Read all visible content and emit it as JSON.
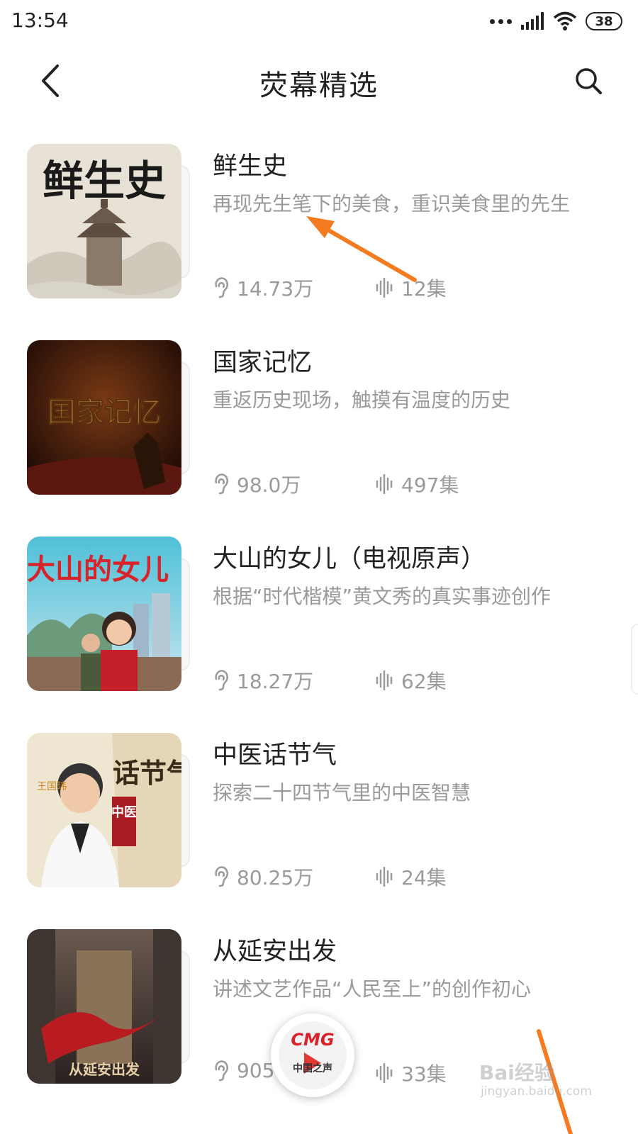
{
  "status_bar": {
    "time": "13:54",
    "battery": "38"
  },
  "header": {
    "title": "荧幕精选"
  },
  "items": [
    {
      "title": "鲜生史",
      "desc": "再现先生笔下的美食，重识美食里的先生",
      "plays": "14.73万",
      "episodes": "12集",
      "cover_text": "鲜生史"
    },
    {
      "title": "国家记忆",
      "desc": "重返历史现场，触摸有温度的历史",
      "plays": "98.0万",
      "episodes": "497集",
      "cover_text": "国家记忆"
    },
    {
      "title": "大山的女儿（电视原声）",
      "desc": "根据“时代楷模”黄文秀的真实事迹创作",
      "plays": "18.27万",
      "episodes": "62集",
      "cover_text": "大山的女儿"
    },
    {
      "title": "中医话节气",
      "desc": "探索二十四节气里的中医智慧",
      "plays": "80.25万",
      "episodes": "24集",
      "cover_text": "话节气",
      "cover_sub": "中医",
      "cover_name": "王国玮"
    },
    {
      "title": "从延安出发",
      "desc": "讲述文艺作品“人民至上”的创作初心",
      "plays": "905",
      "episodes": "33集",
      "cover_text": "从延安出发"
    }
  ],
  "player": {
    "logo": "CMG",
    "sub": "中国之声"
  },
  "watermark": {
    "main": "Bai经验",
    "sub": "jingyan.baidu.com"
  },
  "colors": {
    "accent_arrow": "#f47b20",
    "meta_gray": "#9a9a9a"
  }
}
